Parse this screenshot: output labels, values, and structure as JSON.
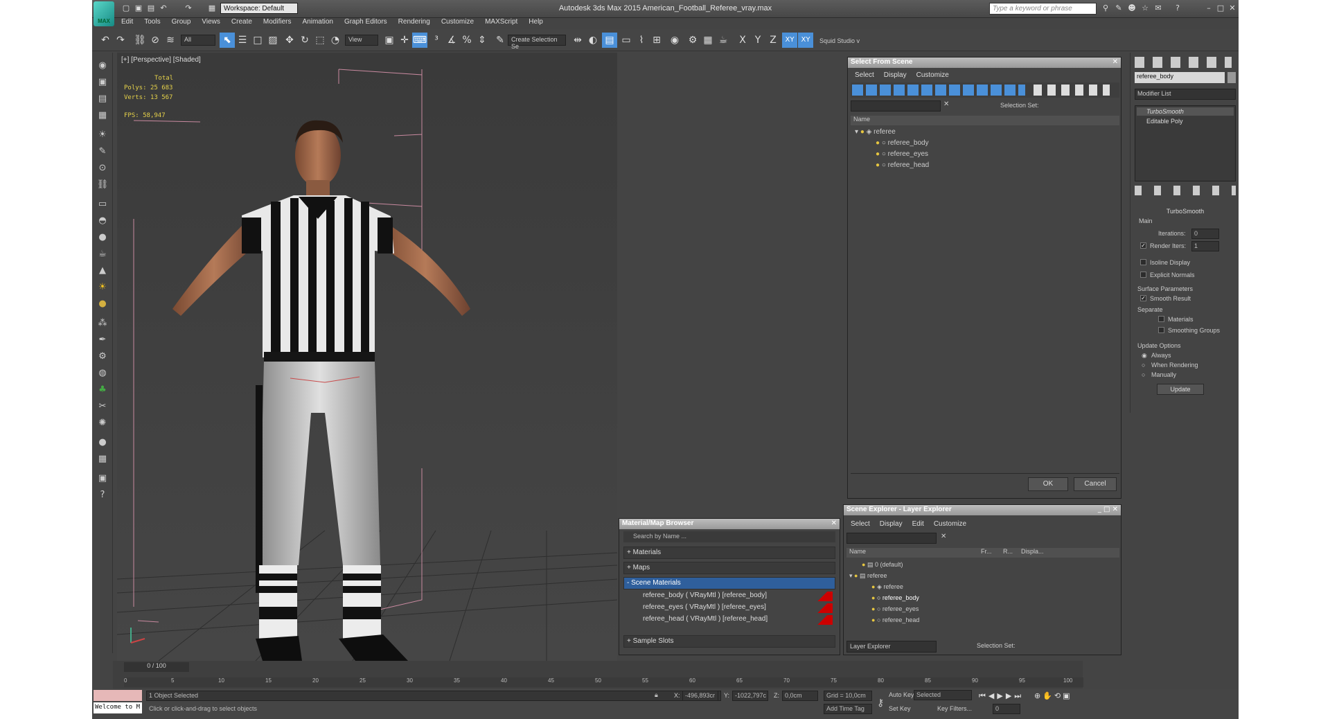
{
  "title_bar": {
    "logo": "MAX",
    "workspace": "Workspace: Default",
    "title": "Autodesk 3ds Max  2015    American_Football_Referee_vray.max",
    "search_placeholder": "Type a keyword or phrase"
  },
  "menu": [
    "Edit",
    "Tools",
    "Group",
    "Views",
    "Create",
    "Modifiers",
    "Animation",
    "Graph Editors",
    "Rendering",
    "Customize",
    "MAXScript",
    "Help"
  ],
  "toolbar": {
    "filter": "All",
    "view": "View",
    "selection_set": "Create Selection Se",
    "axes": [
      "X",
      "Y",
      "Z",
      "XY",
      "XY"
    ],
    "extra": "Squid Studio v"
  },
  "viewport": {
    "label": "[+] [Perspective] [Shaded]",
    "stats": {
      "total": "Total",
      "polys_label": "Polys:",
      "polys": "25 683",
      "verts_label": "Verts:",
      "verts": "13 567",
      "fps_label": "FPS:",
      "fps": "58,947"
    }
  },
  "select_from_scene": {
    "title": "Select From Scene",
    "menu": [
      "Select",
      "Display",
      "Customize"
    ],
    "selection_set": "Selection Set:",
    "column": "Name",
    "items": [
      "referee",
      "referee_body",
      "referee_eyes",
      "referee_head"
    ],
    "ok": "OK",
    "cancel": "Cancel"
  },
  "material_browser": {
    "title": "Material/Map Browser",
    "search": "Search by Name ...",
    "groups": [
      "+ Materials",
      "+ Maps",
      "- Scene Materials"
    ],
    "materials": [
      "referee_body  ( VRayMtl )  [referee_body]",
      "referee_eyes  ( VRayMtl )  [referee_eyes]",
      "referee_head  ( VRayMtl )  [referee_head]"
    ],
    "sample_slots": "+ Sample Slots"
  },
  "scene_explorer": {
    "title": "Scene Explorer - Layer Explorer",
    "menu": [
      "Select",
      "Display",
      "Edit",
      "Customize"
    ],
    "columns": [
      "Name",
      "Fr...",
      "R...",
      "Displa..."
    ],
    "items": [
      "0 (default)",
      "referee",
      "referee",
      "referee_body",
      "referee_eyes",
      "referee_head"
    ],
    "footer_left": "Layer Explorer",
    "footer_right": "Selection Set:"
  },
  "command_panel": {
    "object_name": "referee_body",
    "modifier_list": "Modifier List",
    "stack": [
      "TurboSmooth",
      "Editable Poly"
    ],
    "rollout_title": "TurboSmooth",
    "main": "Main",
    "iterations_label": "Iterations:",
    "iterations": "0",
    "render_iters_label": "Render Iters:",
    "render_iters": "1",
    "isoline": "Isoline Display",
    "explicit": "Explicit Normals",
    "surface_params": "Surface Parameters",
    "smooth_result": "Smooth Result",
    "separate": "Separate",
    "materials": "Materials",
    "smoothing_groups": "Smoothing Groups",
    "update_options": "Update Options",
    "always": "Always",
    "when_rendering": "When Rendering",
    "manually": "Manually",
    "update": "Update"
  },
  "timeline": {
    "frame": "0 / 100",
    "ticks": [
      "0",
      "5",
      "10",
      "15",
      "20",
      "25",
      "30",
      "35",
      "40",
      "45",
      "50",
      "55",
      "60",
      "65",
      "70",
      "75",
      "80",
      "85",
      "90",
      "95",
      "100"
    ]
  },
  "status": {
    "welcome": "Welcome to M",
    "selected": "1 Object Selected",
    "prompt": "Click or click-and-drag to select objects",
    "x_label": "X:",
    "x": "-496,893cr",
    "y_label": "Y:",
    "y": "-1022,797c",
    "z_label": "Z:",
    "z": "0,0cm",
    "grid": "Grid = 10,0cm",
    "add_time_tag": "Add Time Tag",
    "auto_key": "Auto Key",
    "selected_mode": "Selected",
    "set_key": "Set Key",
    "key_filters": "Key Filters...",
    "frame_field": "0"
  }
}
